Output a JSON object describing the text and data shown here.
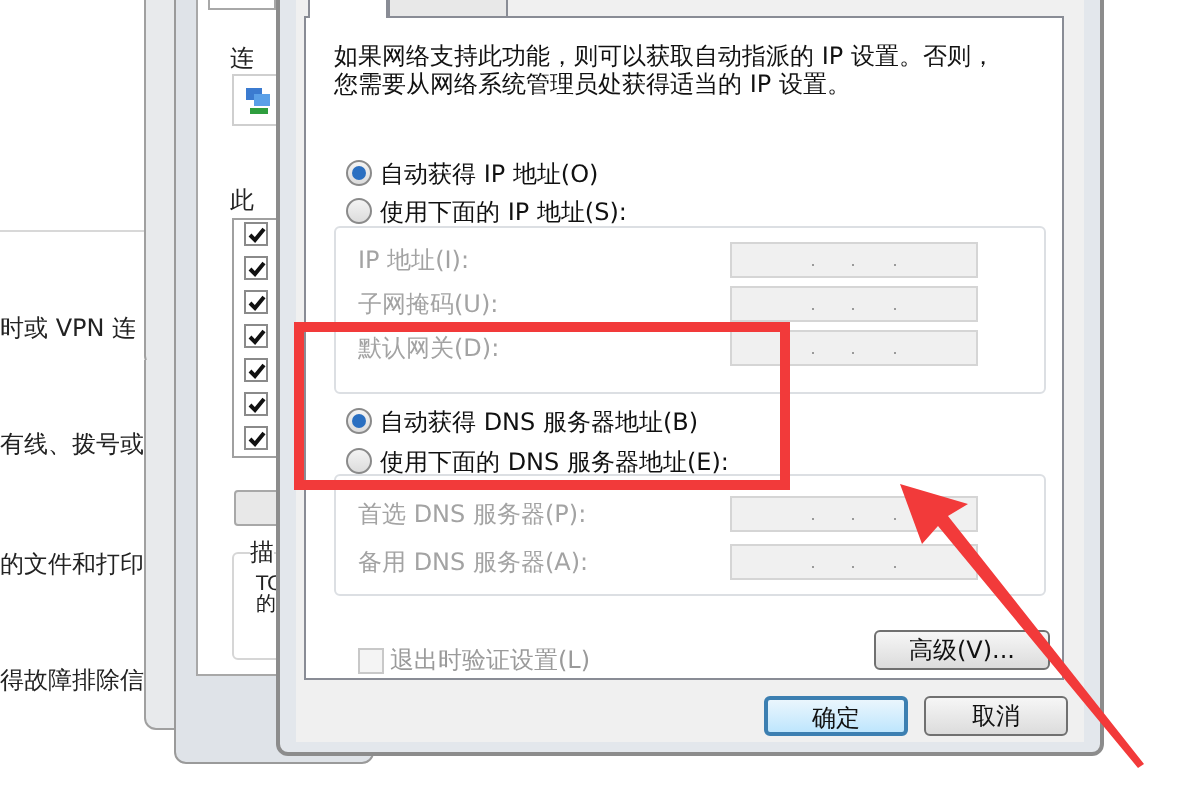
{
  "background_panel": {
    "lines": [
      "时或 VPN 连",
      "有线、拨号或",
      "的文件和打印",
      "得故障排除信"
    ]
  },
  "middle_window": {
    "connect_label": "连",
    "items_label": "此",
    "items": [
      {
        "checked": true
      },
      {
        "checked": true
      },
      {
        "checked": true
      },
      {
        "checked": true
      },
      {
        "checked": true
      },
      {
        "checked": true
      },
      {
        "checked": true
      }
    ],
    "description_label": "描",
    "description_lines": [
      "TC",
      "的"
    ]
  },
  "dialog": {
    "tabs": [
      {
        "selected": true
      },
      {
        "selected": false
      }
    ],
    "intro": [
      "如果网络支持此功能，则可以获取自动指派的 IP 设置。否则，",
      "您需要从网络系统管理员处获得适当的 IP 设置。"
    ],
    "ip_options": [
      {
        "label": "自动获得 IP 地址(O)",
        "selected": true
      },
      {
        "label": "使用下面的 IP 地址(S):",
        "selected": false
      }
    ],
    "ip_fields": [
      {
        "label": "IP 地址(I):",
        "disabled": true
      },
      {
        "label": "子网掩码(U):",
        "disabled": true
      },
      {
        "label": "默认网关(D):",
        "disabled": true
      }
    ],
    "dns_options": [
      {
        "label": "自动获得 DNS 服务器地址(B)",
        "selected": true
      },
      {
        "label": "使用下面的 DNS 服务器地址(E):",
        "selected": false
      }
    ],
    "dns_fields": [
      {
        "label": "首选 DNS 服务器(P):",
        "disabled": true
      },
      {
        "label": "备用 DNS 服务器(A):",
        "disabled": true
      }
    ],
    "validate": {
      "label": "退出时验证设置(L)",
      "checked": false,
      "disabled": true
    },
    "advanced_button": "高级(V)...",
    "buttons": [
      {
        "label": "确定",
        "default": true
      },
      {
        "label": "取消",
        "default": false
      }
    ]
  }
}
